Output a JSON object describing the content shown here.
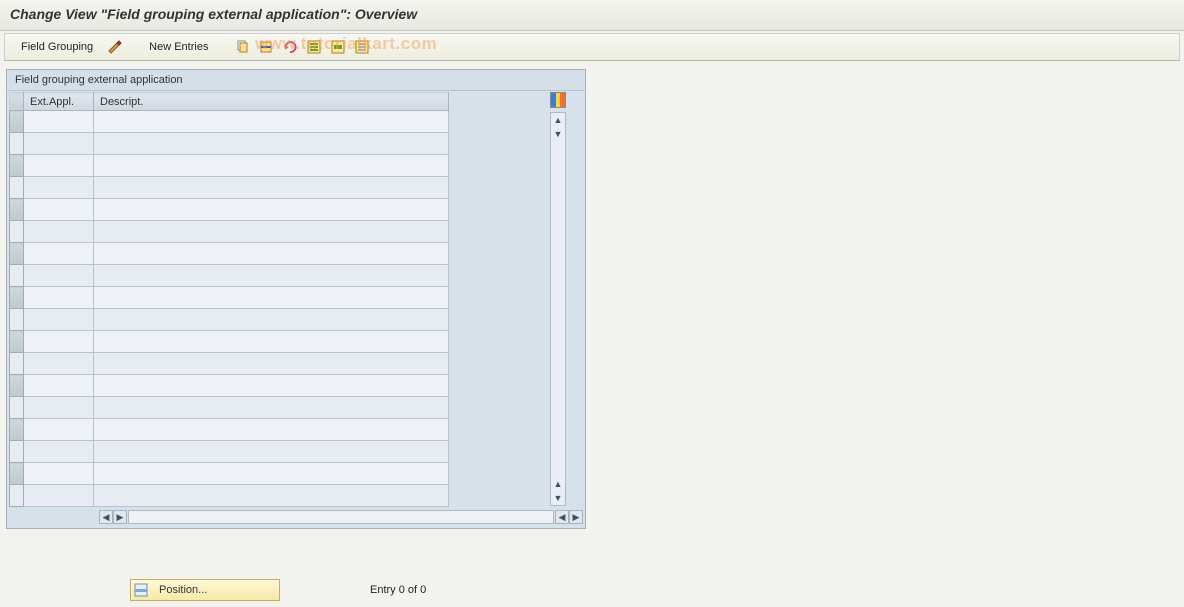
{
  "header": {
    "title": "Change View \"Field grouping external application\": Overview"
  },
  "toolbar": {
    "field_grouping_label": "Field Grouping",
    "new_entries_label": "New Entries"
  },
  "panel": {
    "title": "Field grouping external application",
    "columns": {
      "ext_appl": "Ext.Appl.",
      "descript": "Descript."
    }
  },
  "footer": {
    "position_label": "Position...",
    "entry_text": "Entry 0 of 0"
  },
  "watermark": "www.tutorialkart.com"
}
